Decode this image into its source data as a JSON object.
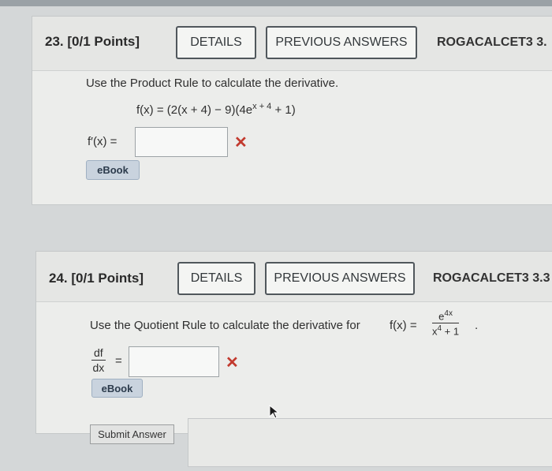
{
  "q23": {
    "number": "23. [0/1 Points]",
    "details_label": "DETAILS",
    "prev_label": "PREVIOUS ANSWERS",
    "course": "ROGACALCET3 3.",
    "prompt": "Use the Product Rule to calculate the derivative.",
    "fx_left": "f(x) = (2(x + 4) − 9)(4e",
    "fx_sup": "x + 4",
    "fx_right": " + 1)",
    "answer_label": "f′(x) =",
    "answer_value": "",
    "ebook": "eBook"
  },
  "q24": {
    "number": "24. [0/1 Points]",
    "details_label": "DETAILS",
    "prev_label": "PREVIOUS ANSWERS",
    "course": "ROGACALCET3 3.3",
    "prompt": "Use the Quotient Rule to calculate the derivative for",
    "fx": "f(x) =",
    "frac_num": "e",
    "frac_num_sup": "4x",
    "frac_den": "x",
    "frac_den_sup": "4",
    "frac_den_tail": " + 1",
    "period": ".",
    "df": "df",
    "dx": "dx",
    "eq": "=",
    "answer_value": "",
    "ebook": "eBook"
  },
  "submit_label": "Submit Answer",
  "x_mark": "✕",
  "colors": {
    "error": "#c23a2e",
    "ebook_bg": "#c9d3de"
  }
}
